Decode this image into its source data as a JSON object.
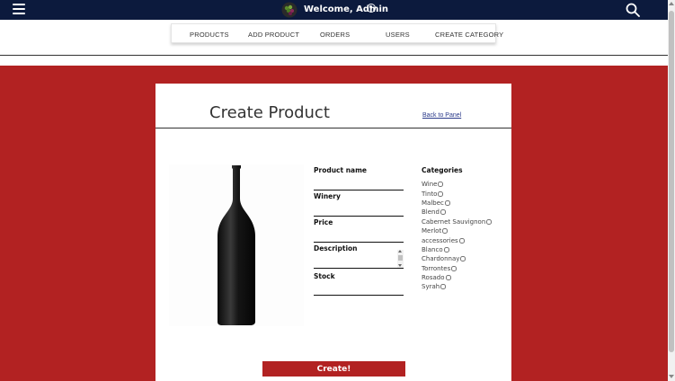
{
  "header": {
    "welcome_text": "Welcome,  Admin",
    "icons": {
      "menu": "hamburger-menu-icon",
      "logo": "wine-logo-icon",
      "user": "user-icon",
      "search": "search-icon"
    },
    "colors": {
      "topbar": "#0c1a3d",
      "accent": "#b22222"
    }
  },
  "admin_nav": {
    "items": [
      {
        "label": "PRODUCTS"
      },
      {
        "label": "ADD PRODUCT"
      },
      {
        "label": "ORDERS"
      },
      {
        "label": "USERS"
      },
      {
        "label": "CREATE CATEGORY"
      }
    ]
  },
  "form": {
    "title": "Create Product",
    "back_link": "Back to Panel",
    "fields": {
      "product_name": {
        "label": "Product name",
        "value": ""
      },
      "winery": {
        "label": "Winery",
        "value": ""
      },
      "price": {
        "label": "Price",
        "value": ""
      },
      "description": {
        "label": "Description",
        "value": ""
      },
      "stock": {
        "label": "Stock",
        "value": ""
      }
    },
    "categories_title": "Categories",
    "categories": [
      "Wine",
      "Tinto",
      "Malbec",
      "Blend",
      "Cabernet Sauvignon",
      "Merlot",
      "accessories",
      "Blanco",
      "Chardonnay",
      "Torrontes",
      "Rosado",
      "Syrah"
    ],
    "submit_label": "Create!"
  }
}
